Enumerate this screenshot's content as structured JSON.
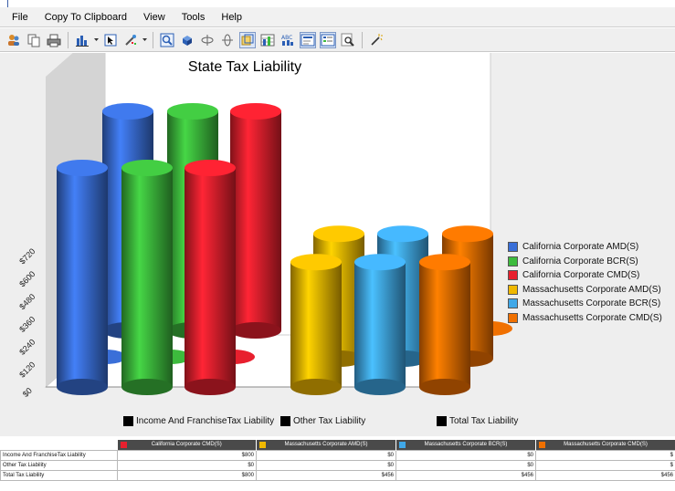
{
  "menubar": {
    "items": [
      "File",
      "Copy To Clipboard",
      "View",
      "Tools",
      "Help"
    ]
  },
  "toolbar": {
    "icons": [
      "people-icon",
      "copy-icon",
      "print-icon",
      "chart-type-icon",
      "select-icon",
      "paint-icon",
      "zoom-in-icon",
      "3d-icon",
      "rotate-horizontal-icon",
      "rotate-vertical-icon",
      "depth-icon",
      "grid-icon",
      "data-labels-icon",
      "chart-title-icon",
      "legend-icon",
      "zoom-icon",
      "wizard-icon"
    ]
  },
  "chart_data": {
    "type": "bar",
    "title": "State Tax Liability",
    "xlabel": "",
    "ylabel": "",
    "ylim": [
      0,
      720
    ],
    "yticks": [
      "$0",
      "$120",
      "$240",
      "$360",
      "$480",
      "$600",
      "$720"
    ],
    "categories": [
      "Income And FranchiseTax Liability",
      "Other Tax Liability",
      "Total Tax Liability"
    ],
    "legend_position": "right",
    "series": [
      {
        "name": "California Corporate AMD(S)",
        "color": "#3a6fd8",
        "values": [
          800,
          0,
          800
        ]
      },
      {
        "name": "California Corporate BCR(S)",
        "color": "#3dbb3d",
        "values": [
          800,
          0,
          800
        ]
      },
      {
        "name": "California Corporate CMD(S)",
        "color": "#e8202e",
        "values": [
          800,
          0,
          800
        ]
      },
      {
        "name": "Massachusetts Corporate AMD(S)",
        "color": "#f0b800",
        "values": [
          0,
          456,
          456
        ]
      },
      {
        "name": "Massachusetts Corporate BCR(S)",
        "color": "#40a8e8",
        "values": [
          0,
          456,
          456
        ]
      },
      {
        "name": "Massachusetts Corporate CMD(S)",
        "color": "#f07000",
        "values": [
          0,
          456,
          456
        ]
      }
    ]
  },
  "category_legend": [
    "Income And FranchiseTax Liability",
    "Other Tax Liability",
    "Total Tax Liability"
  ],
  "table": {
    "headers": [
      "California Corporate CMD(S)",
      "Massachusetts Corporate AMD(S)",
      "Massachusetts Corporate BCR(S)",
      "Massachusetts Corporate CMD(S)"
    ],
    "header_colors": [
      "#e8202e",
      "#f0b800",
      "#40a8e8",
      "#f07000"
    ],
    "rows": [
      {
        "label": "Income And FranchiseTax Liability",
        "cells": [
          "$800",
          "$0",
          "$0",
          "$"
        ]
      },
      {
        "label": "Other Tax Liability",
        "cells": [
          "$0",
          "$0",
          "$0",
          "$"
        ]
      },
      {
        "label": "Total Tax Liability",
        "cells": [
          "$800",
          "$456",
          "$456",
          "$456"
        ]
      }
    ]
  }
}
